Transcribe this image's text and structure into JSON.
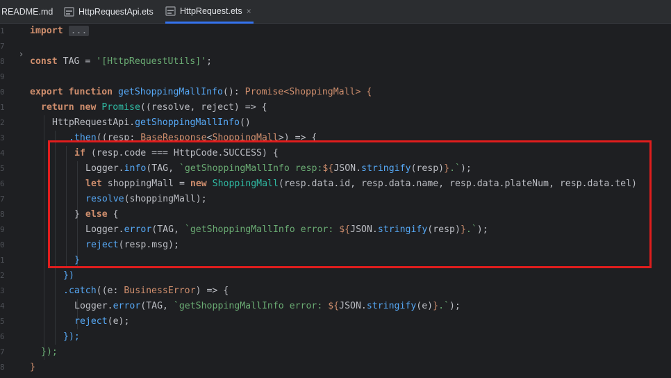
{
  "tabs": [
    {
      "label": "README.md",
      "icon": "markdown-file-icon",
      "active": false
    },
    {
      "label": "HttpRequestApi.ets",
      "icon": "ets-file-icon",
      "active": false
    },
    {
      "label": "HttpRequest.ets",
      "icon": "ets-file-icon",
      "active": true
    }
  ],
  "tab_close": "×",
  "gutter": {
    "line_numbers": [
      "1",
      "7",
      "8",
      "9",
      "0",
      "1",
      "2",
      "3",
      "4",
      "5",
      "6",
      "7",
      "8",
      "9",
      "0",
      "1",
      "2",
      "3",
      "4",
      "5",
      "6",
      "7",
      "8"
    ],
    "fold_marker": "›"
  },
  "code": {
    "l1": {
      "import": "import",
      "collapsed": "..."
    },
    "l3": {
      "const": "const",
      "name": " TAG = ",
      "value": "'[HttpRequestUtils]'",
      "end": ";"
    },
    "l5": {
      "export": "export",
      "function": " function ",
      "fname": "getShoppingMallInfo",
      "p": "(): ",
      "promise": "Promise",
      "lt": "<",
      "type": "ShoppingMall",
      "gt": "> {"
    },
    "l6": {
      "return": "return",
      "new": " new ",
      "promise": "Promise",
      "rest": "((resolve, reject) => {"
    },
    "l7": {
      "api": "HttpRequestApi.",
      "call": "getShoppingMallInfo",
      "rest": "()"
    },
    "l8": {
      "then": ".then",
      "p1": "((resp: ",
      "type": "BaseResponse",
      "lt": "<",
      "type2": "ShoppingMall",
      "rest": ">) => {"
    },
    "l9": {
      "if": "if",
      "rest": " (resp.code === HttpCode.SUCCESS) {"
    },
    "l10": {
      "obj": "Logger.",
      "method": "info",
      "a": "(TAG, ",
      "s1": "`getShoppingMallInfo resp:",
      "d": "${",
      "json": "JSON.",
      "stringify": "stringify",
      "arg": "(resp)",
      "de": "}",
      "s2": ".`",
      "end": ");"
    },
    "l11": {
      "let": "let",
      "var": " shoppingMall = ",
      "new": "new ",
      "cls": "ShoppingMall",
      "rest": "(resp.data.id, resp.data.name, resp.data.plateNum, resp.data.tel)"
    },
    "l12": {
      "resolve": "resolve",
      "rest": "(shoppingMall);"
    },
    "l13": {
      "close": "} ",
      "else": "else",
      "open": " {"
    },
    "l14": {
      "obj": "Logger.",
      "method": "error",
      "a": "(TAG, ",
      "s1": "`getShoppingMallInfo error: ",
      "d": "${",
      "json": "JSON.",
      "stringify": "stringify",
      "arg": "(resp)",
      "de": "}",
      "s2": ".`",
      "end": ");"
    },
    "l15": {
      "reject": "reject",
      "rest": "(resp.msg);"
    },
    "l16": {
      "close": "}"
    },
    "l17": {
      "close": "})"
    },
    "l18": {
      "catch": ".catch",
      "p1": "((e: ",
      "type": "BusinessError",
      "rest": ") => {"
    },
    "l19": {
      "obj": "Logger.",
      "method": "error",
      "a": "(TAG, ",
      "s1": "`getShoppingMallInfo error: ",
      "d": "${",
      "json": "JSON.",
      "stringify": "stringify",
      "arg": "(e)",
      "de": "}",
      "s2": ".`",
      "end": ");"
    },
    "l20": {
      "reject": "reject",
      "rest": "(e);"
    },
    "l21": {
      "close": "});"
    },
    "l22": {
      "close": "});"
    },
    "l23": {
      "close": "}"
    }
  },
  "colors": {
    "highlight_box": "#e01d1d",
    "active_tab_underline": "#3574f0"
  }
}
